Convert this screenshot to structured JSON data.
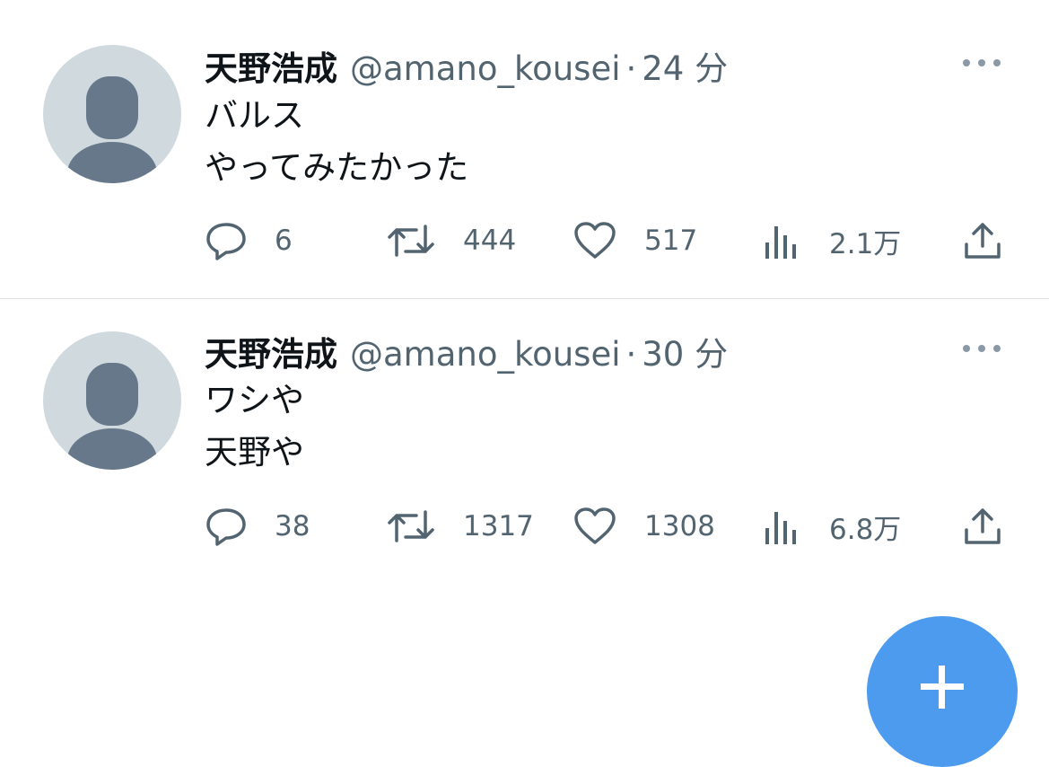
{
  "tweets": [
    {
      "name": "天野浩成",
      "handle": "@amano_kousei",
      "separator": "·",
      "time": "24 分",
      "lines": [
        "バルス",
        "やってみたかった"
      ],
      "replies": "6",
      "retweets": "444",
      "likes": "517",
      "views": "2.1万"
    },
    {
      "name": "天野浩成",
      "handle": "@amano_kousei",
      "separator": "·",
      "time": "30 分",
      "lines": [
        "ワシや",
        "天野や"
      ],
      "replies": "38",
      "retweets": "1317",
      "likes": "1308",
      "views": "6.8万"
    }
  ],
  "icons": {
    "reply": "reply-icon",
    "retweet": "retweet-icon",
    "like": "heart-icon",
    "views": "views-icon",
    "share": "share-icon",
    "more": "more-icon",
    "compose": "plus-icon"
  },
  "colors": {
    "text": "#0f1419",
    "secondary": "#536471",
    "avatar_bg": "#cfd9de",
    "avatar_fg": "#66788a",
    "fab": "#4c9bef"
  }
}
